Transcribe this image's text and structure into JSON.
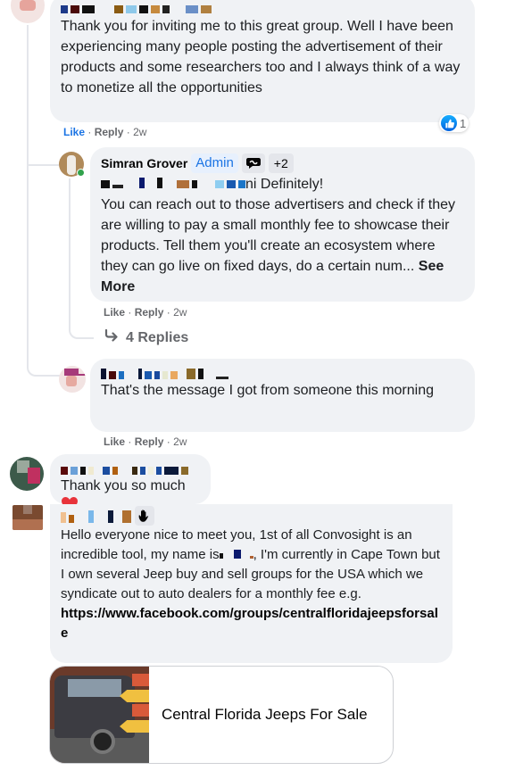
{
  "comments": [
    {
      "author": "",
      "text": "Thank you for inviting me to this great group. Well I have been experiencing many people posting the advertisement of their products and some researchers too and I always think of a way to monetize all the opportunities",
      "reaction_count": "1",
      "actions": {
        "like": "Like",
        "reply": "Reply",
        "time": "2w"
      },
      "replies": [
        {
          "author": "Simran Grover",
          "badge": "Admin",
          "badge_extra": "+2",
          "mention_suffix": "ni",
          "first_line": "Definitely!",
          "text": "You can reach out to those advertisers and check if they are willing to pay a small monthly fee to showcase their products. Tell them you'll create an ecosystem where they can go live on fixed days, do a certain num...",
          "see_more": "See More",
          "actions": {
            "like": "Like",
            "reply": "Reply",
            "time": "2w"
          },
          "replies_link": "4 Replies"
        },
        {
          "author": "",
          "text": "That's the message I got from someone this morning",
          "actions": {
            "like": "Like",
            "reply": "Reply",
            "time": "2w"
          }
        }
      ]
    },
    {
      "author": "",
      "text": "Thank you so much",
      "emoji": "❤️"
    },
    {
      "author": "",
      "text": "Hello everyone nice to meet you, 1st of all Convosight is an incredible tool, my name is",
      "text_after_name": ", I'm currently in Cape Town but I own several Jeep buy and sell groups for the USA which we syndicate out to auto dealers for a monthly fee e.g.",
      "link": "https://www.facebook.com/groups/centralfloridajeepsforsale",
      "link_card": {
        "title": "Central Florida Jeeps For Sale"
      }
    }
  ],
  "colors": {
    "bubble": "#f0f2f5",
    "accent": "#1b74e4",
    "secondary_text": "#65676b",
    "online": "#31a24c"
  }
}
